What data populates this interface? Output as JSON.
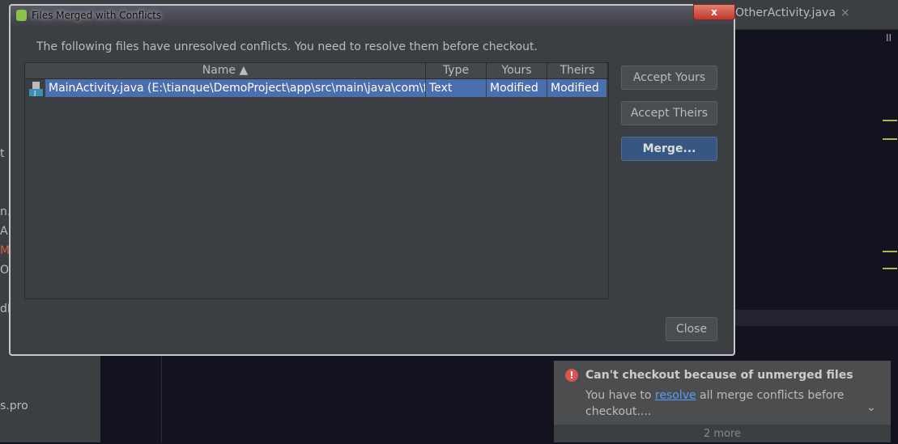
{
  "ide": {
    "tab_label": "OtherActivity.java",
    "tab_close": "×",
    "pause": "II",
    "left_fragments": [
      "t",
      "n.f",
      "A",
      "M",
      "O",
      "dN",
      "s.pro"
    ]
  },
  "dialog": {
    "title": "Files Merged with Conflicts",
    "close": "x",
    "message": "The following files have unresolved conflicts. You need to resolve them before checkout.",
    "columns": [
      "Name ▲",
      "Type",
      "Yours",
      "Theirs"
    ],
    "rows": [
      {
        "name": "MainActivity.java (E:\\tianque\\DemoProject\\app\\src\\main\\java\\com\\fly",
        "type": "Text",
        "yours": "Modified",
        "theirs": "Modified"
      }
    ],
    "buttons": {
      "accept_yours": "Accept Yours",
      "accept_theirs": "Accept Theirs",
      "merge": "Merge...",
      "close": "Close"
    }
  },
  "notification": {
    "icon": "error-icon",
    "title": "Can't checkout because of unmerged files",
    "body_pre": "You have to ",
    "link": "resolve",
    "body_post": " all merge conflicts before checkout....",
    "more": "2 more"
  },
  "colors": {
    "selection": "#4b6eaf",
    "merge_button": "#365880",
    "error": "#d9534f",
    "link": "#589df6"
  }
}
